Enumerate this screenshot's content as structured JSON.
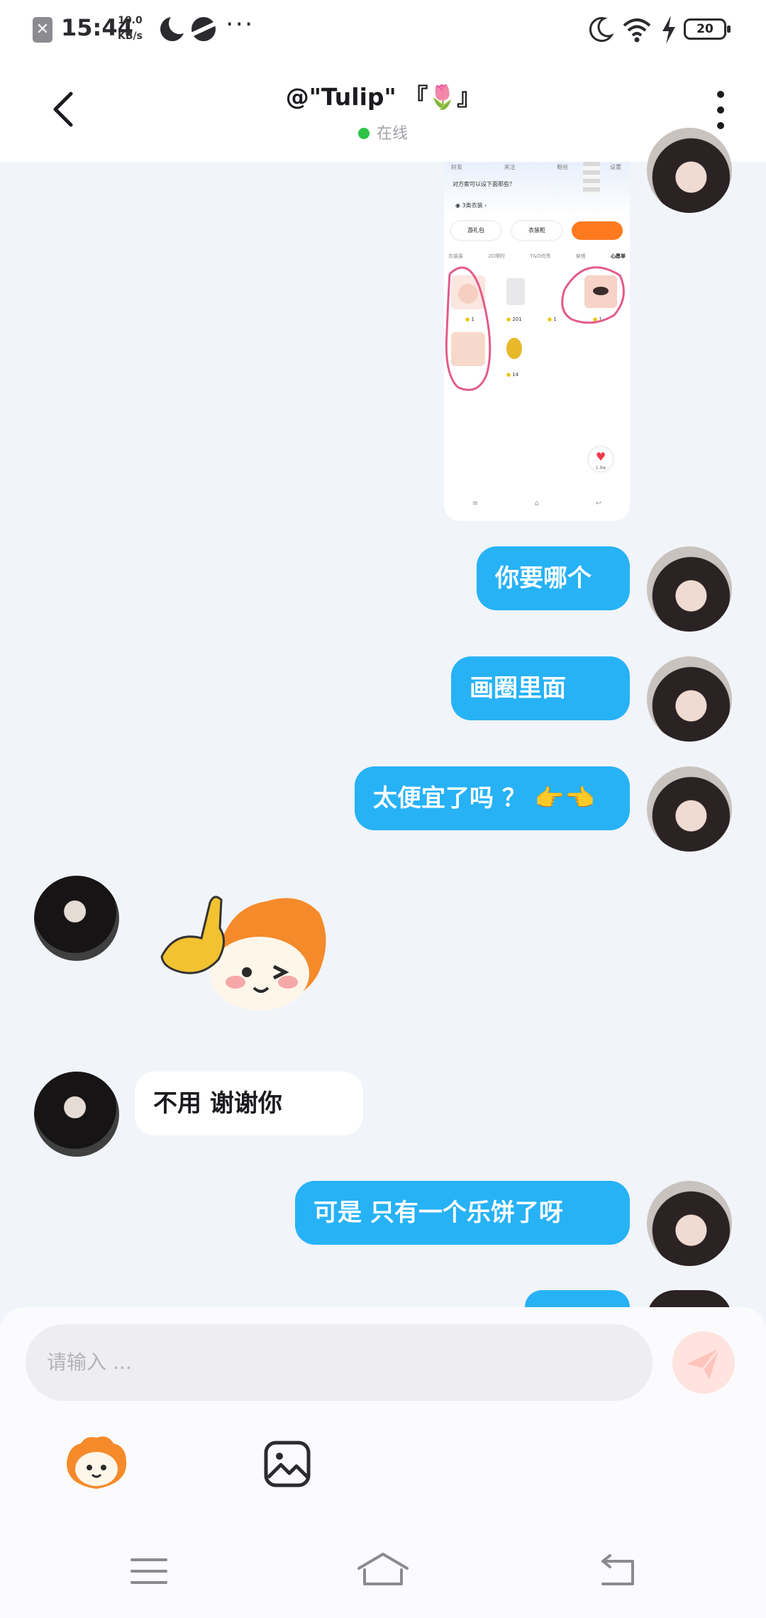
{
  "status_bar": {
    "time": "15:44",
    "net_speed_value": "10.0",
    "net_speed_unit": "KB/s",
    "battery": "20"
  },
  "header": {
    "title": "@\"Tulip\" 『🌷』",
    "status": "在线"
  },
  "screenshot_image": {
    "tabs": [
      "好友",
      "关注",
      "粉丝",
      "设置"
    ],
    "prompt": "对方索可以设下面那些？",
    "buttons": [
      "游礼包",
      "衣装柜"
    ],
    "categories": [
      "衣装装",
      "2D限时",
      "T&O优秀",
      "穿搭",
      "心愿单"
    ],
    "prices": [
      "1",
      "201",
      "1",
      "1",
      "14"
    ],
    "like_count": "1.9w"
  },
  "messages": [
    {
      "text": "你要哪个"
    },
    {
      "text": "画圈里面"
    },
    {
      "text": "太便宜了吗 ？ 👉👈"
    },
    {
      "text": "不用  谢谢你"
    },
    {
      "text": "可是 只有一个乐饼了呀"
    }
  ],
  "input": {
    "placeholder": "请输入 ..."
  }
}
